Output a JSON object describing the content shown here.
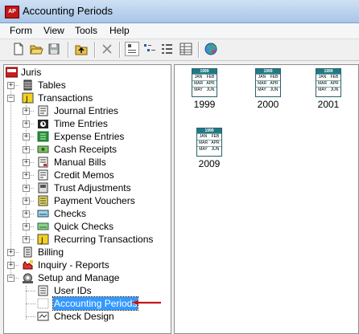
{
  "window": {
    "title": "Accounting Periods",
    "icon_label": "AP"
  },
  "menu": [
    "Form",
    "View",
    "Tools",
    "Help"
  ],
  "toolbar": {
    "buttons": [
      "new-icon",
      "open-folder-icon",
      "save-icon",
      "up-folder-icon",
      "delete-icon",
      "large-icons-view-icon",
      "small-icons-view-icon",
      "list-view-icon",
      "details-view-icon",
      "globe-icon"
    ]
  },
  "tree": {
    "root": "Juris",
    "items": [
      {
        "label": "Tables"
      },
      {
        "label": "Transactions"
      },
      {
        "label": "Journal Entries"
      },
      {
        "label": "Time Entries"
      },
      {
        "label": "Expense Entries"
      },
      {
        "label": "Cash Receipts"
      },
      {
        "label": "Manual Bills"
      },
      {
        "label": "Credit Memos"
      },
      {
        "label": "Trust Adjustments"
      },
      {
        "label": "Payment Vouchers"
      },
      {
        "label": "Checks"
      },
      {
        "label": "Quick Checks"
      },
      {
        "label": "Recurring Transactions"
      },
      {
        "label": "Billing"
      },
      {
        "label": "Inquiry - Reports"
      },
      {
        "label": "Setup and Manage"
      },
      {
        "label": "User IDs"
      },
      {
        "label": "Accounting Periods"
      },
      {
        "label": "Check Design"
      }
    ]
  },
  "periods": {
    "icon_text": {
      "year": "1999",
      "row1": [
        "JAN",
        "FEB"
      ],
      "row2": [
        "MAR",
        "APR"
      ],
      "row3": [
        "MAY",
        "JUN"
      ]
    },
    "items": [
      "1999",
      "2000",
      "2001",
      "2009"
    ]
  },
  "colors": {
    "selection": "#3399ff",
    "arrow": "#c0161d",
    "calendar_header": "#1f7a86"
  }
}
